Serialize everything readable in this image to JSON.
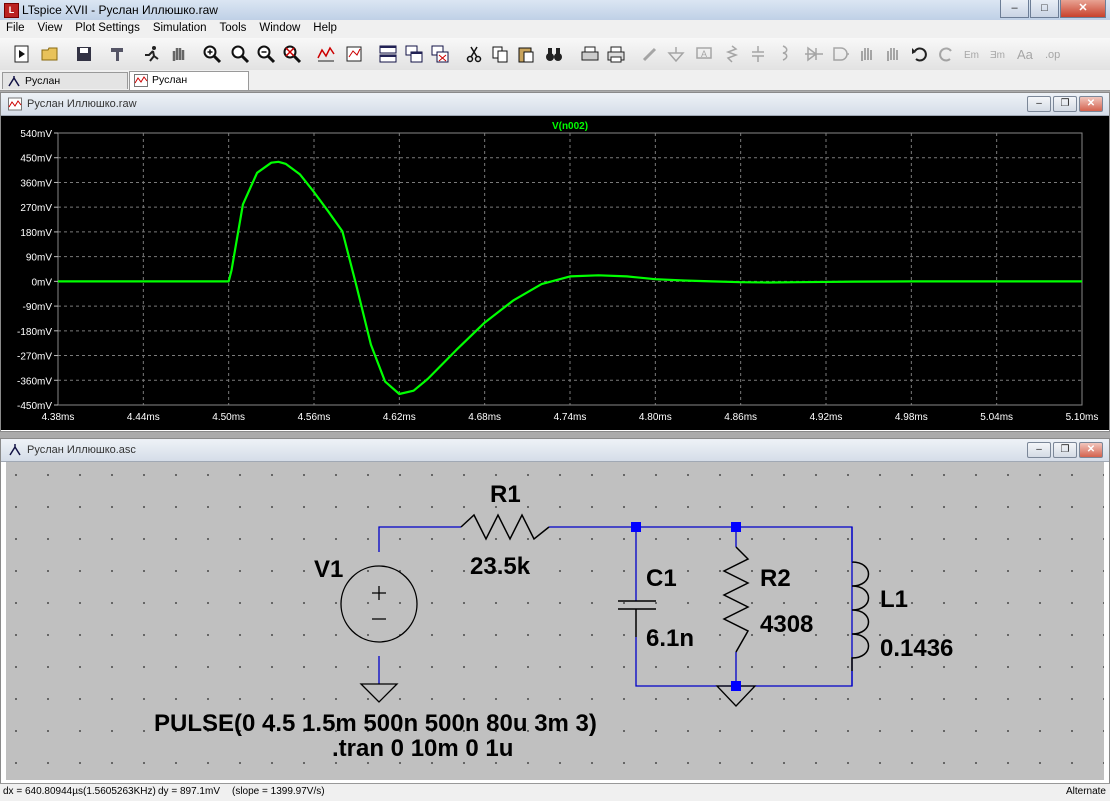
{
  "window": {
    "title": "LTspice XVII - Руслан Иллюшко.raw"
  },
  "menu": [
    "File",
    "View",
    "Plot Settings",
    "Simulation",
    "Tools",
    "Window",
    "Help"
  ],
  "tabs": [
    {
      "label": "Руслан Иллюшко.asc",
      "icon": "schematic-icon"
    },
    {
      "label": "Руслан Иллюшко.raw",
      "icon": "waveform-icon"
    }
  ],
  "plot_window": {
    "title": "Руслан Иллюшко.raw",
    "trace_label": "V(n002)",
    "trace_color": "#00ff00"
  },
  "schematic_window": {
    "title": "Руслан Иллюшко.asc"
  },
  "chart_data": {
    "type": "line",
    "series": [
      {
        "name": "V(n002)",
        "x": [
          4.38,
          4.5,
          4.502,
          4.51,
          4.52,
          4.53,
          4.535,
          4.54,
          4.55,
          4.56,
          4.57,
          4.58,
          4.59,
          4.6,
          4.61,
          4.62,
          4.63,
          4.64,
          4.66,
          4.68,
          4.7,
          4.72,
          4.74,
          4.76,
          4.78,
          4.8,
          4.82,
          4.84,
          4.86,
          4.88,
          4.9,
          4.94,
          4.98,
          5.1
        ],
        "y": [
          0,
          0,
          40,
          280,
          395,
          432,
          435,
          428,
          390,
          325,
          255,
          182,
          -20,
          -230,
          -365,
          -410,
          -398,
          -355,
          -250,
          -150,
          -70,
          -10,
          18,
          22,
          18,
          8,
          3,
          0,
          -3,
          -4,
          -3,
          -1,
          0,
          0
        ]
      }
    ],
    "xlim": [
      4.38,
      5.1
    ],
    "ylim": [
      -450,
      540
    ],
    "xticks": [
      "4.38ms",
      "4.44ms",
      "4.50ms",
      "4.56ms",
      "4.62ms",
      "4.68ms",
      "4.74ms",
      "4.80ms",
      "4.86ms",
      "4.92ms",
      "4.98ms",
      "5.04ms",
      "5.10ms"
    ],
    "yticks": [
      "540mV",
      "450mV",
      "360mV",
      "270mV",
      "180mV",
      "90mV",
      "0mV",
      "-90mV",
      "-180mV",
      "-270mV",
      "-360mV",
      "-450mV"
    ],
    "grid": true
  },
  "schematic": {
    "v1": {
      "name": "V1"
    },
    "r1": {
      "name": "R1",
      "value": "23.5k"
    },
    "c1": {
      "name": "C1",
      "value": "6.1n"
    },
    "r2": {
      "name": "R2",
      "value": "4308"
    },
    "l1": {
      "name": "L1",
      "value": "0.1436"
    },
    "source_spec": "PULSE(0 4.5 1.5m 500n 500n 80u 3m 3)",
    "directive": ".tran 0 10m 0 1u",
    "wire_color": "#0000c8",
    "node_color": "#0000ff"
  },
  "status": {
    "dx": "dx = 640.80944µs(1.5605263KHz)",
    "dy": "dy = 897.1mV",
    "slope": "(slope = 1399.97V/s)",
    "mode": "Alternate"
  }
}
